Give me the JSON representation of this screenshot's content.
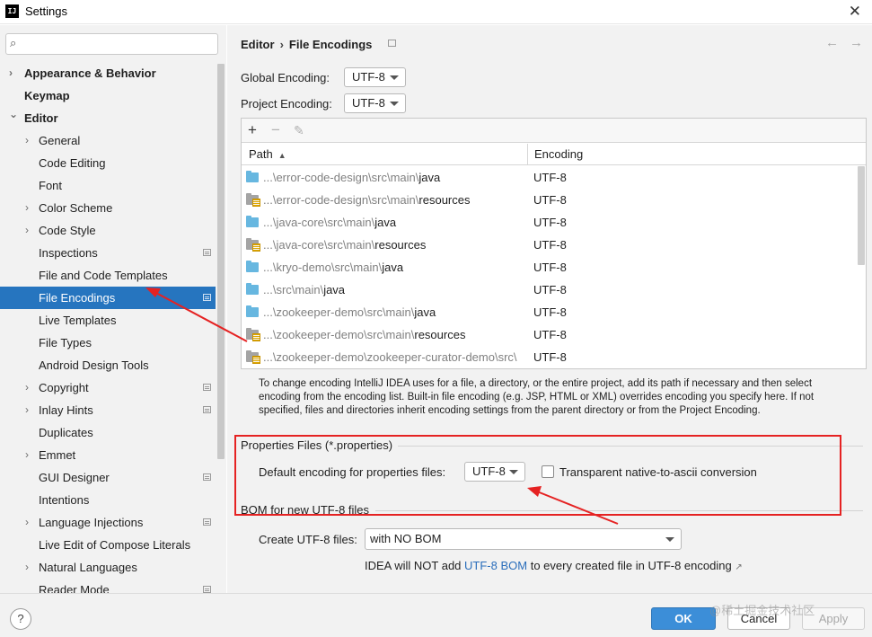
{
  "window": {
    "title": "Settings",
    "close_glyph": "✕"
  },
  "search": {
    "placeholder": "",
    "value": ""
  },
  "sidebar": {
    "items": [
      {
        "label": "Appearance & Behavior",
        "level": 0,
        "expandable": true,
        "expanded": false,
        "bold": true
      },
      {
        "label": "Keymap",
        "level": 0,
        "expandable": false,
        "bold": true
      },
      {
        "label": "Editor",
        "level": 0,
        "expandable": true,
        "expanded": true,
        "bold": true
      },
      {
        "label": "General",
        "level": 1,
        "expandable": true
      },
      {
        "label": "Code Editing",
        "level": 1
      },
      {
        "label": "Font",
        "level": 1
      },
      {
        "label": "Color Scheme",
        "level": 1,
        "expandable": true
      },
      {
        "label": "Code Style",
        "level": 1,
        "expandable": true
      },
      {
        "label": "Inspections",
        "level": 1,
        "project_icon": true
      },
      {
        "label": "File and Code Templates",
        "level": 1
      },
      {
        "label": "File Encodings",
        "level": 1,
        "selected": true,
        "project_icon": true
      },
      {
        "label": "Live Templates",
        "level": 1
      },
      {
        "label": "File Types",
        "level": 1
      },
      {
        "label": "Android Design Tools",
        "level": 1
      },
      {
        "label": "Copyright",
        "level": 1,
        "expandable": true,
        "project_icon": true
      },
      {
        "label": "Inlay Hints",
        "level": 1,
        "expandable": true,
        "project_icon": true
      },
      {
        "label": "Duplicates",
        "level": 1
      },
      {
        "label": "Emmet",
        "level": 1,
        "expandable": true
      },
      {
        "label": "GUI Designer",
        "level": 1,
        "project_icon": true
      },
      {
        "label": "Intentions",
        "level": 1
      },
      {
        "label": "Language Injections",
        "level": 1,
        "expandable": true,
        "project_icon": true
      },
      {
        "label": "Live Edit of Compose Literals",
        "level": 1
      },
      {
        "label": "Natural Languages",
        "level": 1,
        "expandable": true
      },
      {
        "label": "Reader Mode",
        "level": 1,
        "project_icon": true
      }
    ]
  },
  "breadcrumb": {
    "parent": "Editor",
    "separator": "›",
    "current": "File Encodings"
  },
  "nav": {
    "back": "←",
    "forward": "→"
  },
  "global_encoding": {
    "label": "Global Encoding:",
    "value": "UTF-8"
  },
  "project_encoding": {
    "label": "Project Encoding:",
    "value": "UTF-8"
  },
  "table": {
    "toolbar": {
      "add": "+",
      "remove": "−",
      "edit": "✎"
    },
    "columns": {
      "path": "Path",
      "sort": "▲",
      "encoding": "Encoding"
    },
    "rows": [
      {
        "prefix": "...\\error-code-design\\src\\main\\",
        "leaf": "java",
        "encoding": "UTF-8",
        "type": "src"
      },
      {
        "prefix": "...\\error-code-design\\src\\main\\",
        "leaf": "resources",
        "encoding": "UTF-8",
        "type": "res"
      },
      {
        "prefix": "...\\java-core\\src\\main\\",
        "leaf": "java",
        "encoding": "UTF-8",
        "type": "src"
      },
      {
        "prefix": "...\\java-core\\src\\main\\",
        "leaf": "resources",
        "encoding": "UTF-8",
        "type": "res"
      },
      {
        "prefix": "...\\kryo-demo\\src\\main\\",
        "leaf": "java",
        "encoding": "UTF-8",
        "type": "src"
      },
      {
        "prefix": "...\\src\\main\\",
        "leaf": "java",
        "encoding": "UTF-8",
        "type": "src"
      },
      {
        "prefix": "...\\zookeeper-demo\\src\\main\\",
        "leaf": "java",
        "encoding": "UTF-8",
        "type": "src"
      },
      {
        "prefix": "...\\zookeeper-demo\\src\\main\\",
        "leaf": "resources",
        "encoding": "UTF-8",
        "type": "res"
      },
      {
        "prefix": "...\\zookeeper-demo\\zookeeper-curator-demo\\src\\",
        "leaf": "",
        "encoding": "UTF-8",
        "type": "res"
      }
    ]
  },
  "help_text": "To change encoding IntelliJ IDEA uses for a file, a directory, or the entire project, add its path if necessary and then select encoding from the encoding list. Built-in file encoding (e.g. JSP, HTML or XML) overrides encoding you specify here. If not specified, files and directories inherit encoding settings from the parent directory or from the Project Encoding.",
  "properties": {
    "title": "Properties Files (*.properties)",
    "default_label": "Default encoding for properties files:",
    "default_value": "UTF-8",
    "native_label": "Transparent native-to-ascii conversion",
    "native_checked": false
  },
  "bom": {
    "title": "BOM for new UTF-8 files",
    "create_label": "Create UTF-8 files:",
    "create_value": "with NO BOM",
    "info_pre": "IDEA will NOT add ",
    "info_link": "UTF-8 BOM",
    "info_post": " to every created file in UTF-8 encoding",
    "info_icon": "↗"
  },
  "footer": {
    "help": "?",
    "ok": "OK",
    "cancel": "Cancel",
    "apply": "Apply"
  },
  "watermark": "@稀土掘金技术社区",
  "colors": {
    "accent": "#2675bf",
    "highlight": "#e52222",
    "link": "#2a6ebb"
  }
}
